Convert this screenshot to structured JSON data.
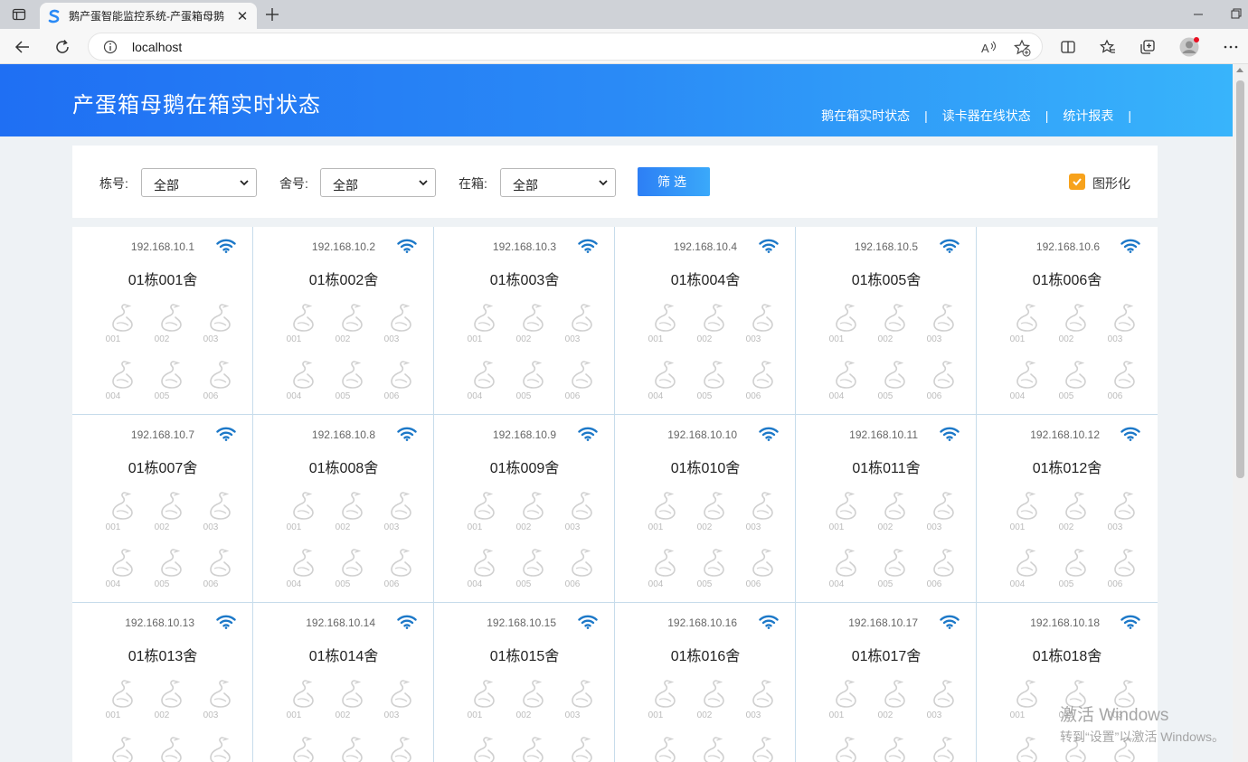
{
  "browser": {
    "tab_title": "鹅产蛋智能监控系统-产蛋箱母鹅",
    "url": "localhost"
  },
  "banner": {
    "title": "产蛋箱母鹅在箱实时状态",
    "nav": [
      "鹅在箱实时状态",
      "读卡器在线状态",
      "统计报表"
    ],
    "separator": "|"
  },
  "filter": {
    "building_label": "栋号:",
    "building_value": "全部",
    "room_label": "舍号:",
    "room_value": "全部",
    "inbox_label": "在箱:",
    "inbox_value": "全部",
    "button_label": "筛选",
    "graphical_label": "图形化",
    "graphical_checked": true
  },
  "colors": {
    "accent": "#2a8af6",
    "wifi": "#1c78c8",
    "checkbox": "#f7a21c"
  },
  "cells": [
    {
      "ip": "192.168.10.1",
      "room": "01栋001舍"
    },
    {
      "ip": "192.168.10.2",
      "room": "01栋002舍"
    },
    {
      "ip": "192.168.10.3",
      "room": "01栋003舍"
    },
    {
      "ip": "192.168.10.4",
      "room": "01栋004舍"
    },
    {
      "ip": "192.168.10.5",
      "room": "01栋005舍"
    },
    {
      "ip": "192.168.10.6",
      "room": "01栋006舍"
    },
    {
      "ip": "192.168.10.7",
      "room": "01栋007舍"
    },
    {
      "ip": "192.168.10.8",
      "room": "01栋008舍"
    },
    {
      "ip": "192.168.10.9",
      "room": "01栋009舍"
    },
    {
      "ip": "192.168.10.10",
      "room": "01栋010舍"
    },
    {
      "ip": "192.168.10.11",
      "room": "01栋011舍"
    },
    {
      "ip": "192.168.10.12",
      "room": "01栋012舍"
    },
    {
      "ip": "192.168.10.13",
      "room": "01栋013舍"
    },
    {
      "ip": "192.168.10.14",
      "room": "01栋014舍"
    },
    {
      "ip": "192.168.10.15",
      "room": "01栋015舍"
    },
    {
      "ip": "192.168.10.16",
      "room": "01栋016舍"
    },
    {
      "ip": "192.168.10.17",
      "room": "01栋017舍"
    },
    {
      "ip": "192.168.10.18",
      "room": "01栋018舍"
    }
  ],
  "boxes": [
    "001",
    "002",
    "003",
    "004",
    "005",
    "006"
  ],
  "watermark": {
    "line1": "激活 Windows",
    "line2": "转到“设置”以激活 Windows。"
  }
}
